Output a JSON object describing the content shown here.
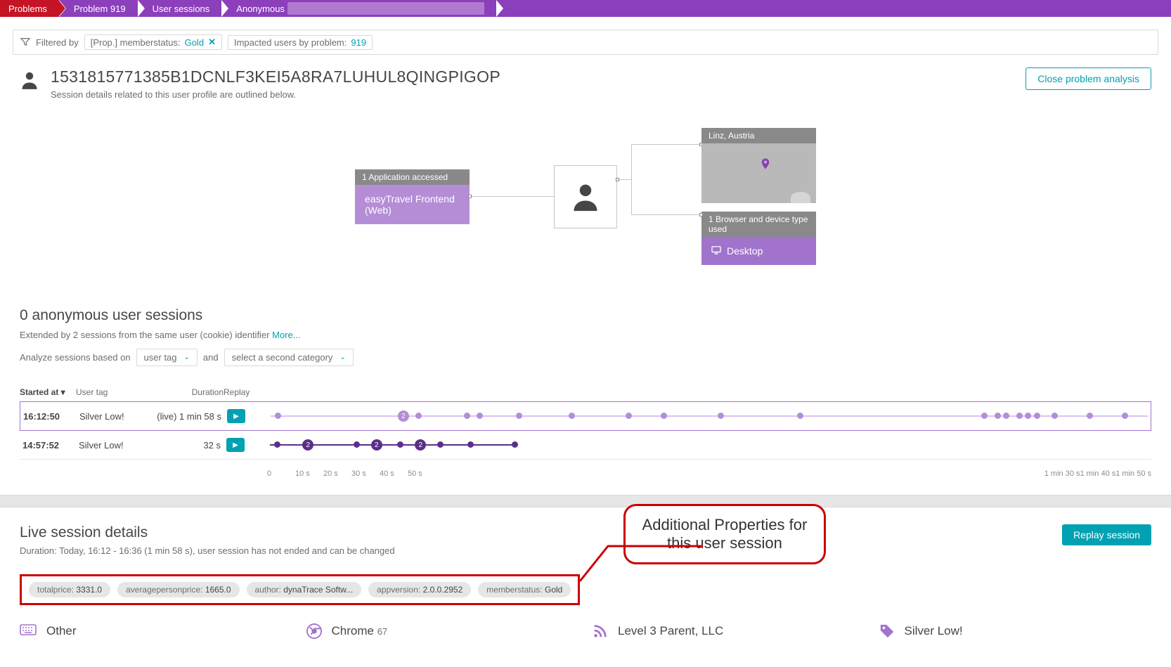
{
  "breadcrumbs": [
    "Problems",
    "Problem 919",
    "User sessions",
    "Anonymous"
  ],
  "filter": {
    "label": "Filtered by",
    "chip1_prefix": "[Prop.] memberstatus:",
    "chip1_value": "Gold",
    "chip2_prefix": "Impacted users by problem:",
    "chip2_value": "919"
  },
  "user": {
    "id": "1531815771385B1DCNLF3KEI5A8RA7LUHUL8QINGPIGOP",
    "subtitle": "Session details related to this user profile are outlined below.",
    "close_btn": "Close problem analysis"
  },
  "diagram": {
    "app_count": "1 Application accessed",
    "app_name": "easyTravel Frontend (Web)",
    "location": "Linz, Austria",
    "device_count": "1 Browser and device type used",
    "device_name": "Desktop"
  },
  "sessions": {
    "heading": "0 anonymous user sessions",
    "extended_prefix": "Extended by 2 sessions from the same user (cookie) identifier ",
    "more_link": "More...",
    "analyze_prefix": "Analyze sessions based on",
    "sel1": "user tag",
    "and": "and",
    "sel2": "select a second category",
    "cols": {
      "started": "Started at ▾",
      "tag": "User tag",
      "duration": "Duration",
      "replay": "Replay"
    },
    "rows": [
      {
        "start": "16:12:50",
        "tag": "Silver Low!",
        "duration": "(live) 1 min 58 s"
      },
      {
        "start": "14:57:52",
        "tag": "Silver Low!",
        "duration": "32 s"
      }
    ],
    "axis": [
      "0",
      "10 s",
      "20 s",
      "30 s",
      "40 s",
      "50 s",
      "1 min 30 s",
      "1 min 40 s",
      "1 min 50 s"
    ]
  },
  "live": {
    "heading": "Live session details",
    "subtitle": "Duration: Today, 16:12 - 16:36 (1 min 58 s), user session has not ended and can be changed",
    "replay_btn": "Replay session"
  },
  "props": [
    {
      "k": "totalprice:",
      "v": "3331.0"
    },
    {
      "k": "averagepersonprice:",
      "v": "1665.0"
    },
    {
      "k": "author:",
      "v": "dynaTrace Softw..."
    },
    {
      "k": "appversion:",
      "v": "2.0.0.2952"
    },
    {
      "k": "memberstatus:",
      "v": "Gold"
    }
  ],
  "annotation": {
    "line1": "Additional Properties for",
    "line2": "this user session"
  },
  "footer": [
    {
      "icon": "keyboard",
      "label": "Other"
    },
    {
      "icon": "chrome",
      "label": "Chrome ",
      "suffix": "67"
    },
    {
      "icon": "rss",
      "label": "Level 3 Parent, LLC"
    },
    {
      "icon": "tag",
      "label": "Silver Low!"
    }
  ],
  "chart_data": {
    "type": "timeline",
    "x_axis_ticks_seconds": [
      0,
      10,
      20,
      30,
      40,
      50,
      90,
      100,
      110
    ],
    "series": [
      {
        "name": "16:12:50 (live)",
        "range_seconds": [
          0,
          118
        ],
        "events": [
          {
            "t": 0.5,
            "n": 1
          },
          {
            "t": 15,
            "n": 2
          },
          {
            "t": 17,
            "n": 1
          },
          {
            "t": 23,
            "n": 1
          },
          {
            "t": 24.5,
            "n": 1
          },
          {
            "t": 29,
            "n": 1
          },
          {
            "t": 35,
            "n": 1
          },
          {
            "t": 42,
            "n": 1
          },
          {
            "t": 46,
            "n": 1
          },
          {
            "t": 53,
            "n": 1
          },
          {
            "t": 62,
            "n": 1
          },
          {
            "t": 95,
            "n": 1
          },
          {
            "t": 96.5,
            "n": 1
          },
          {
            "t": 97.5,
            "n": 1
          },
          {
            "t": 99,
            "n": 1
          },
          {
            "t": 100,
            "n": 1
          },
          {
            "t": 101,
            "n": 1
          },
          {
            "t": 103,
            "n": 1
          },
          {
            "t": 109,
            "n": 1
          },
          {
            "t": 113,
            "n": 1
          }
        ]
      },
      {
        "name": "14:57:52",
        "range_seconds": [
          0,
          32
        ],
        "events": [
          {
            "t": 0.5,
            "n": 1
          },
          {
            "t": 4,
            "n": 2
          },
          {
            "t": 10,
            "n": 1
          },
          {
            "t": 12,
            "n": 2
          },
          {
            "t": 15,
            "n": 1
          },
          {
            "t": 17,
            "n": 2
          },
          {
            "t": 19.5,
            "n": 1
          },
          {
            "t": 23,
            "n": 1
          },
          {
            "t": 28,
            "n": 1
          }
        ]
      }
    ]
  }
}
